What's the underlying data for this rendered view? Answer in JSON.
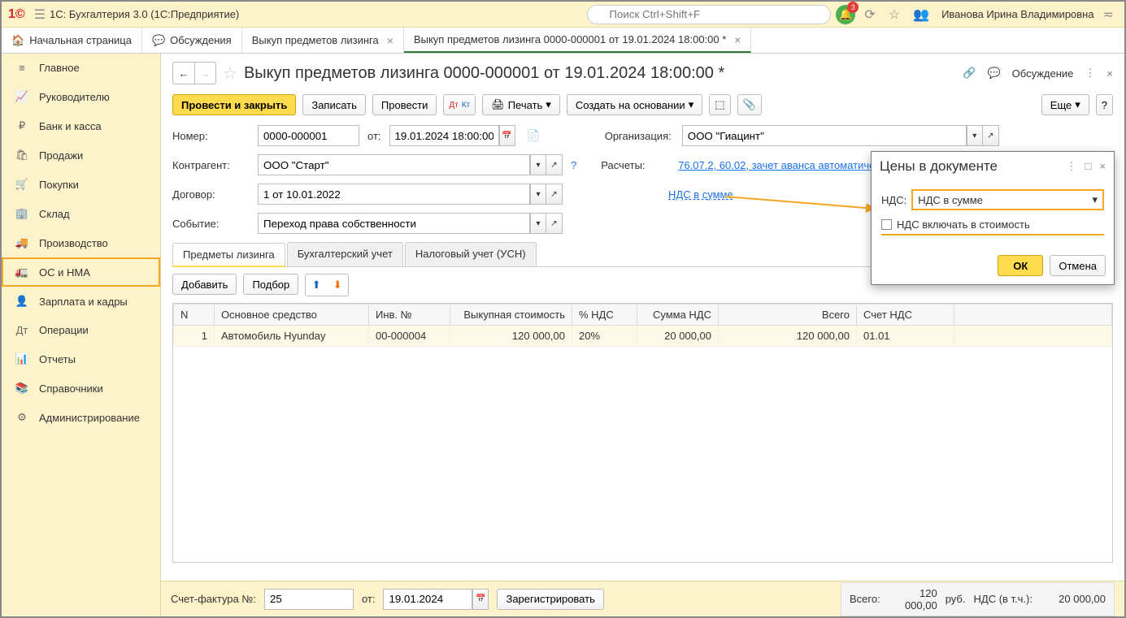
{
  "topbar": {
    "app_title": "1С: Бухгалтерия 3.0  (1С:Предприятие)",
    "search_placeholder": "Поиск Ctrl+Shift+F",
    "bell_badge": "3",
    "username": "Иванова Ирина Владимировна"
  },
  "tabs": [
    {
      "label": "Начальная страница",
      "closable": false,
      "icon": "home"
    },
    {
      "label": "Обсуждения",
      "closable": false,
      "icon": "chat"
    },
    {
      "label": "Выкуп предметов лизинга",
      "closable": true
    },
    {
      "label": "Выкуп предметов лизинга 0000-000001 от 19.01.2024 18:00:00 *",
      "closable": true,
      "active": true
    }
  ],
  "sidenav": [
    {
      "icon": "≡",
      "label": "Главное"
    },
    {
      "icon": "📈",
      "label": "Руководителю"
    },
    {
      "icon": "₽",
      "label": "Банк и касса"
    },
    {
      "icon": "🛍",
      "label": "Продажи"
    },
    {
      "icon": "🛒",
      "label": "Покупки"
    },
    {
      "icon": "🏢",
      "label": "Склад"
    },
    {
      "icon": "🚚",
      "label": "Производство"
    },
    {
      "icon": "🚛",
      "label": "ОС и НМА",
      "selected": true
    },
    {
      "icon": "👤",
      "label": "Зарплата и кадры"
    },
    {
      "icon": "Дт",
      "label": "Операции"
    },
    {
      "icon": "📊",
      "label": "Отчеты"
    },
    {
      "icon": "📚",
      "label": "Справочники"
    },
    {
      "icon": "⚙",
      "label": "Администрирование"
    }
  ],
  "doc": {
    "title": "Выкуп предметов лизинга 0000-000001 от 19.01.2024 18:00:00 *",
    "discuss": "Обсуждение"
  },
  "toolbar": {
    "post_close": "Провести и закрыть",
    "save": "Записать",
    "post": "Провести",
    "print": "Печать",
    "create_from": "Создать на основании",
    "more": "Еще",
    "help": "?"
  },
  "fields": {
    "number_label": "Номер:",
    "number": "0000-000001",
    "from_label": "от:",
    "date": "19.01.2024 18:00:00",
    "org_label": "Организация:",
    "org": "ООО \"Гиацинт\"",
    "contr_label": "Контрагент:",
    "contr": "ООО \"Старт\"",
    "help": "?",
    "calc_label": "Расчеты:",
    "calc_link": "76.07.2, 60.02, зачет аванса автоматически",
    "contract_label": "Договор:",
    "contract": "1 от 10.01.2022",
    "nds_link": "НДС в сумме",
    "event_label": "Событие:",
    "event": "Переход права собственности"
  },
  "inner_tabs": [
    "Предметы лизинга",
    "Бухгалтерский учет",
    "Налоговый учет (УСН)"
  ],
  "tbl_actions": {
    "add": "Добавить",
    "pick": "Подбор"
  },
  "table": {
    "headers": [
      "N",
      "Основное средство",
      "Инв. №",
      "Выкупная стоимость",
      "% НДС",
      "Сумма НДС",
      "Всего",
      "Счет НДС",
      ""
    ],
    "rows": [
      {
        "n": "1",
        "asset": "Автомобиль Hyunday",
        "inv": "00-000004",
        "cost": "120 000,00",
        "vat_pct": "20%",
        "vat_sum": "20 000,00",
        "total": "120 000,00",
        "acct": "01.01"
      }
    ]
  },
  "footer": {
    "invoice_label": "Счет-фактура №:",
    "invoice_no": "25",
    "invoice_from": "от:",
    "invoice_date": "19.01.2024",
    "register": "Зарегистрировать",
    "total_label": "Всего:",
    "total": "120 000,00",
    "currency": "руб.",
    "vat_label": "НДС (в т.ч.):",
    "vat": "20 000,00"
  },
  "popup": {
    "title": "Цены в документе",
    "nds_label": "НДС:",
    "nds_value": "НДС в сумме",
    "checkbox_label": "НДС включать в стоимость",
    "ok": "ОК",
    "cancel": "Отмена"
  }
}
